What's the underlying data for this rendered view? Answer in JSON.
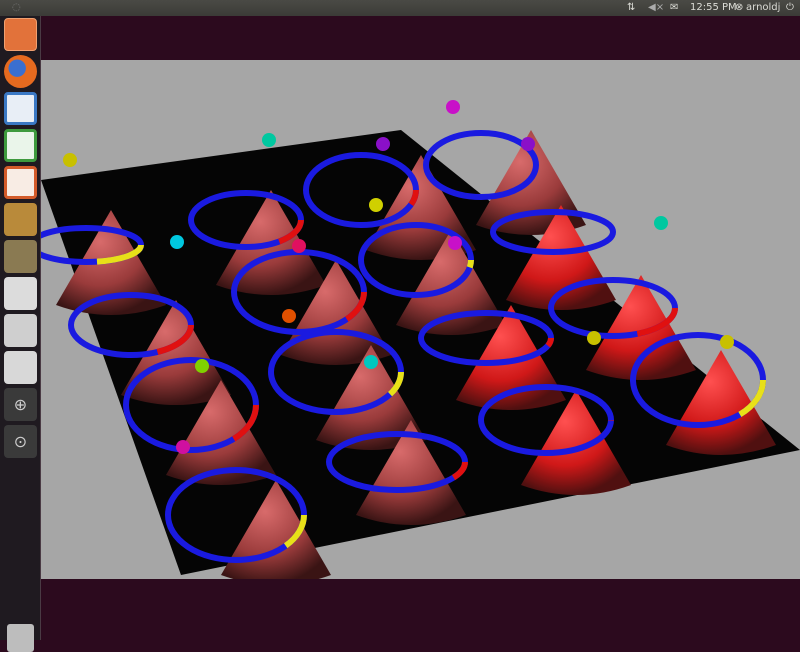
{
  "topbar": {
    "time": "12:55 PM",
    "user": "arnoldj",
    "icons": [
      "network-icon",
      "volume-icon",
      "mail-icon",
      "user-icon",
      "power-icon"
    ]
  },
  "launcher": {
    "items": [
      {
        "name": "home-folder-icon",
        "color": "#e2723a"
      },
      {
        "name": "firefox-icon",
        "color": "#e66a1f"
      },
      {
        "name": "writer-icon",
        "color": "#3a78c4"
      },
      {
        "name": "calc-icon",
        "color": "#3e9a3e"
      },
      {
        "name": "impress-icon",
        "color": "#d35b2a"
      },
      {
        "name": "software-center-icon",
        "color": "#b98a3a"
      },
      {
        "name": "gimp-icon",
        "color": "#8a7a52"
      },
      {
        "name": "inkscape-icon",
        "color": "#2d2d2d"
      },
      {
        "name": "camera-icon",
        "color": "#cfcfcf"
      },
      {
        "name": "terminal-icon",
        "color": "#d8d8d8"
      },
      {
        "name": "zoom-in-icon",
        "color": "#c8c8c8"
      },
      {
        "name": "zoom-reset-icon",
        "color": "#c8c8c8"
      }
    ],
    "trash": "trash-icon"
  },
  "colors": {
    "panel": "#3b3b37",
    "desktop": "#2c0a1e",
    "board_bg": "#a8a8a8",
    "ring_blue": "#1a1ae0",
    "ring_red": "#e01010",
    "ring_yellow": "#e8e018"
  }
}
